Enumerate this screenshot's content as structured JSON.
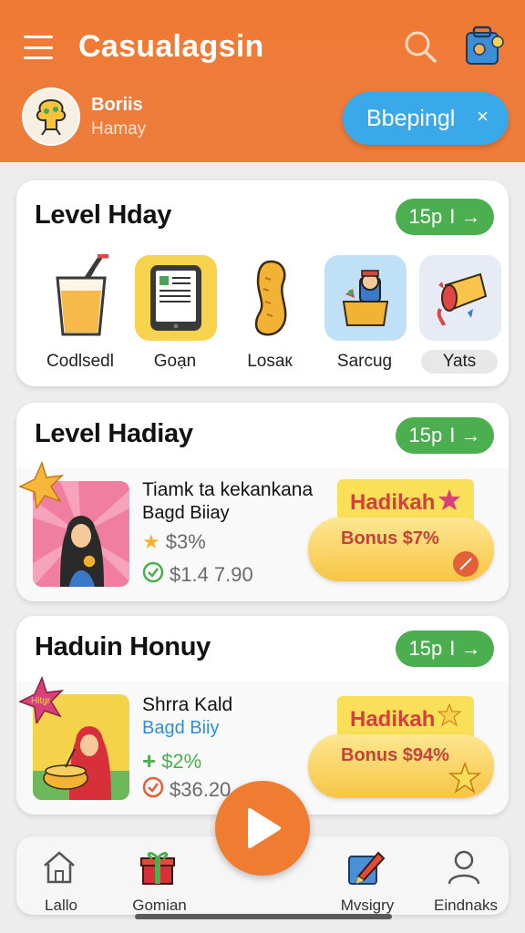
{
  "header": {
    "app_title": "Casualagsin",
    "user_name": "Boriis",
    "user_sub": "Hamay",
    "cta_label": "Bbepingl",
    "cta_close": "×"
  },
  "section1": {
    "title": "Level Hday",
    "pill_label": "15p",
    "pill_arrow": "I →",
    "items": [
      {
        "label": "Codlsedl",
        "icon": "juice-glass-icon"
      },
      {
        "label": "Goạn",
        "icon": "tablet-icon"
      },
      {
        "label": "Losaк",
        "icon": "bean-icon"
      },
      {
        "label": "Sarcug",
        "icon": "box-character-icon"
      },
      {
        "label": "Yats",
        "icon": "paint-bucket-icon"
      }
    ]
  },
  "section2": {
    "title": "Level Hadiay",
    "pill_label": "15p",
    "pill_arrow": "I →",
    "item_title": "Tiamk ta kekankana",
    "item_sub": "Bagd Biiay",
    "rating": "$3%",
    "price": "$1.4 7.90",
    "bonus_tag": "Hadikah",
    "bonus_text": "Bonus $7%"
  },
  "section3": {
    "title": "Haduin Honuy",
    "pill_label": "15p",
    "pill_arrow": "I →",
    "badge_text": "Hitgr",
    "item_title": "Shrra Kald",
    "item_sub": "Bagd Biiy",
    "rating": "$2%",
    "price": "$36.20",
    "bonus_tag": "Hadikah",
    "bonus_text": "Bonus $94%"
  },
  "nav": {
    "items": [
      {
        "label": "Lallo",
        "icon": "home-icon"
      },
      {
        "label": "Gomian",
        "icon": "gift-icon"
      },
      {
        "label": "Mvsigry",
        "icon": "edit-icon"
      },
      {
        "label": "Eindnaks",
        "icon": "profile-icon"
      }
    ],
    "play_icon": "play-icon"
  },
  "colors": {
    "header": "#ef7a35",
    "accent_blue": "#3aa9ea",
    "pill_green": "#4caf4f",
    "play_orange": "#ef7c30",
    "bonus_yellow": "#f9e058"
  }
}
